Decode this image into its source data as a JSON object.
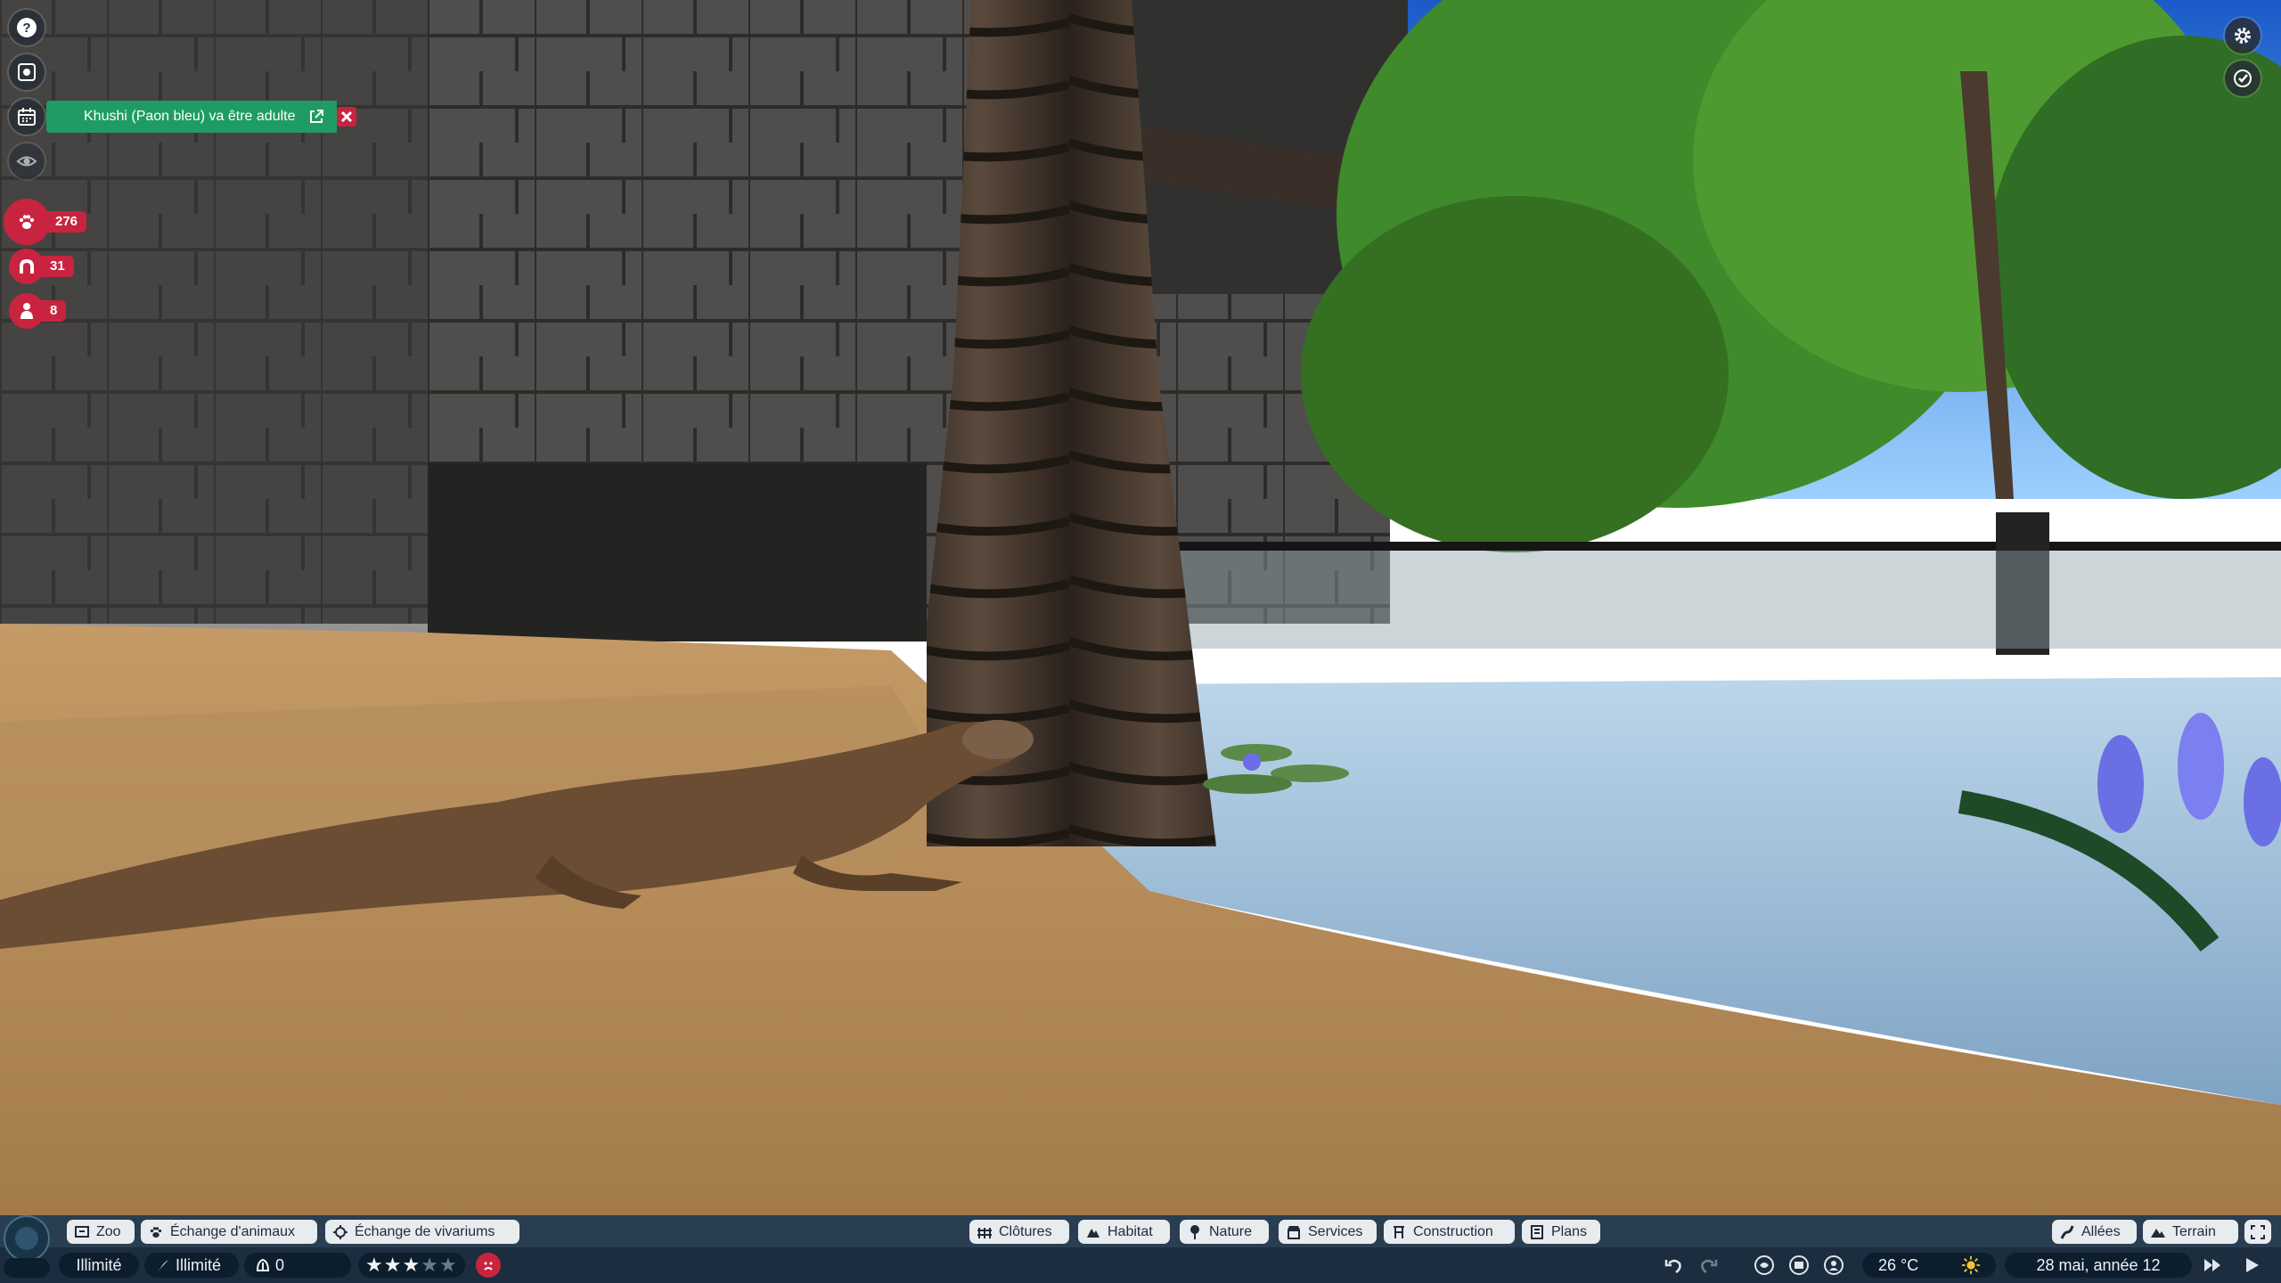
{
  "notification": {
    "text": "Khushi (Paon bleu) va être adulte",
    "icon": "open-external-icon"
  },
  "left_rail": {
    "buttons": [
      "help-icon",
      "zoo-overview-icon",
      "calendar-icon",
      "visibility-icon"
    ]
  },
  "stats": {
    "animals": "276",
    "staff": "31",
    "guests": "8"
  },
  "top_right": {
    "buttons": [
      "settings-gear-icon",
      "photo-mode-icon"
    ]
  },
  "menu_left": [
    {
      "label": "Zoo",
      "icon": "zoo-icon"
    },
    {
      "label": "Échange d'animaux",
      "icon": "paw-icon"
    },
    {
      "label": "Échange de vivariums",
      "icon": "vivarium-icon"
    }
  ],
  "menu_center": [
    {
      "label": "Clôtures",
      "icon": "fence-icon"
    },
    {
      "label": "Habitat",
      "icon": "habitat-icon"
    },
    {
      "label": "Nature",
      "icon": "tree-icon"
    },
    {
      "label": "Services",
      "icon": "shop-icon"
    },
    {
      "label": "Construction",
      "icon": "build-icon"
    },
    {
      "label": "Plans",
      "icon": "blueprint-icon"
    }
  ],
  "menu_right": [
    {
      "label": "Allées",
      "icon": "path-icon"
    },
    {
      "label": "Terrain",
      "icon": "terrain-icon"
    }
  ],
  "status": {
    "money": "Illimité",
    "research": "Illimité",
    "conservation": "0",
    "zoo_rating_stars": 3,
    "zoo_rating_max": 5,
    "temperature": "26 °C",
    "date": "28 mai, année 12"
  },
  "colors": {
    "accent_red": "#c8243f",
    "notification_green": "#1f9c64",
    "bar_blue": "#182e42"
  }
}
